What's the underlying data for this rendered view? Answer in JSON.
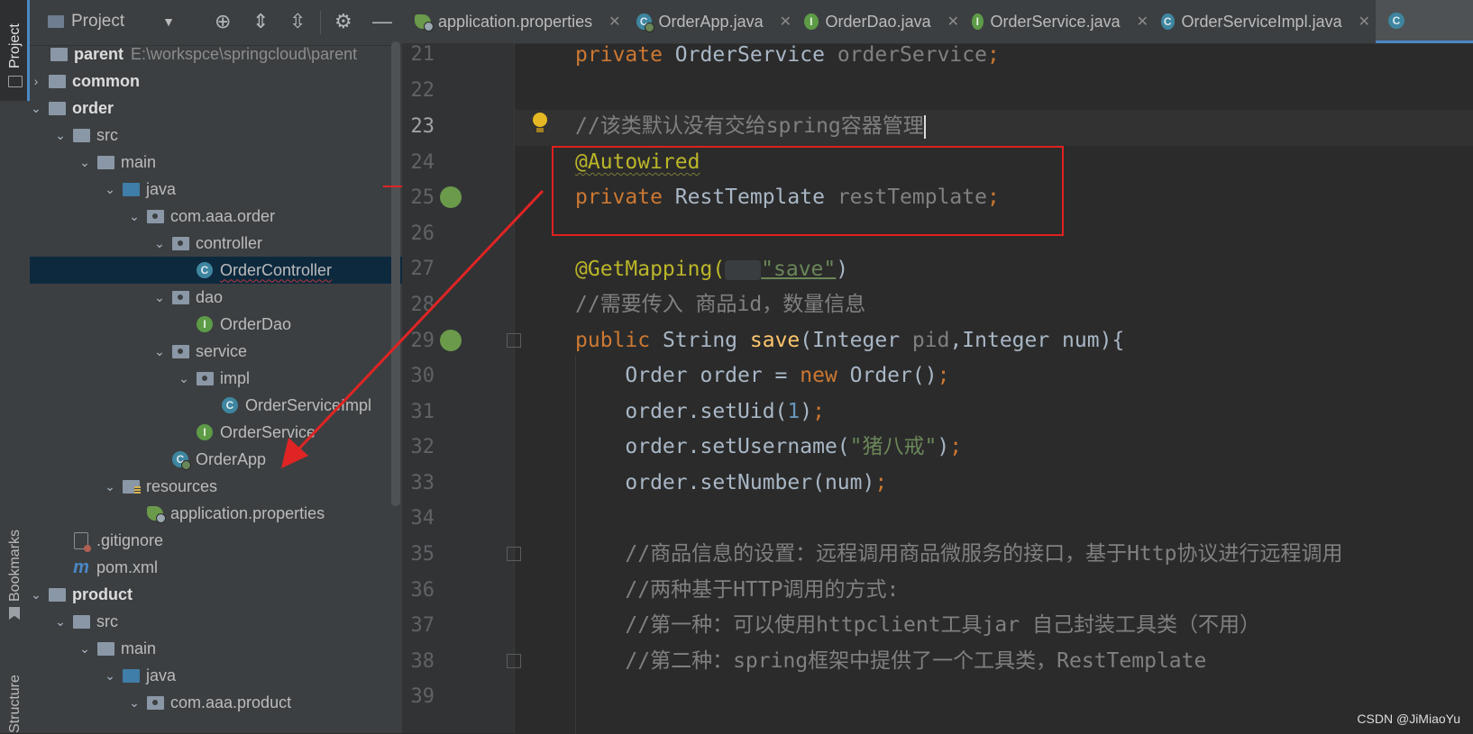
{
  "left_strip": {
    "project_label": "Project",
    "bookmarks_label": "Bookmarks",
    "structure_label": "Structure"
  },
  "project_panel": {
    "title": "Project",
    "tree": [
      {
        "name": "parent",
        "path": "E:\\workspce\\springcloud\\parent",
        "bold": true,
        "icon": "module-folder-icon"
      },
      {
        "name": "common",
        "bold": true,
        "icon": "module-folder-icon",
        "collapsed": true
      },
      {
        "name": "order",
        "bold": true,
        "icon": "module-folder-icon",
        "expanded": true
      },
      {
        "name": "src",
        "icon": "folder-icon",
        "expanded": true
      },
      {
        "name": "main",
        "icon": "folder-icon",
        "expanded": true
      },
      {
        "name": "java",
        "icon": "source-folder-icon",
        "expanded": true
      },
      {
        "name": "com.aaa.order",
        "icon": "package-icon",
        "expanded": true
      },
      {
        "name": "controller",
        "icon": "package-icon",
        "expanded": true
      },
      {
        "name": "OrderController",
        "icon": "class-icon",
        "selected": true
      },
      {
        "name": "dao",
        "icon": "package-icon",
        "expanded": true
      },
      {
        "name": "OrderDao",
        "icon": "interface-icon"
      },
      {
        "name": "service",
        "icon": "package-icon",
        "expanded": true
      },
      {
        "name": "impl",
        "icon": "package-icon",
        "expanded": true
      },
      {
        "name": "OrderServiceImpl",
        "icon": "class-icon"
      },
      {
        "name": "OrderService",
        "icon": "interface-icon"
      },
      {
        "name": "OrderApp",
        "icon": "spring-boot-class-icon"
      },
      {
        "name": "resources",
        "icon": "resources-folder-icon",
        "expanded": true
      },
      {
        "name": "application.properties",
        "icon": "spring-properties-icon"
      },
      {
        "name": ".gitignore",
        "icon": "gitignore-icon"
      },
      {
        "name": "pom.xml",
        "icon": "maven-icon"
      },
      {
        "name": "product",
        "bold": true,
        "icon": "module-folder-icon",
        "expanded": true
      },
      {
        "name": "src",
        "icon": "folder-icon",
        "expanded": true
      },
      {
        "name": "main",
        "icon": "folder-icon",
        "expanded": true
      },
      {
        "name": "java",
        "icon": "source-folder-icon",
        "expanded": true
      },
      {
        "name": "com.aaa.product",
        "icon": "package-icon",
        "expanded": true
      }
    ]
  },
  "tabs": [
    {
      "label": "application.properties",
      "icon": "spring-properties-icon"
    },
    {
      "label": "OrderApp.java",
      "icon": "spring-boot-class-icon"
    },
    {
      "label": "OrderDao.java",
      "icon": "interface-icon"
    },
    {
      "label": "OrderService.java",
      "icon": "interface-icon"
    },
    {
      "label": "OrderServiceImpl.java",
      "icon": "class-icon"
    }
  ],
  "editor": {
    "line_numbers": [
      "21",
      "22",
      "23",
      "24",
      "25",
      "26",
      "27",
      "28",
      "29",
      "30",
      "31",
      "32",
      "33",
      "34",
      "35",
      "36",
      "37",
      "38",
      "39"
    ],
    "lines": {
      "l21_kw": "private",
      "l21_type": " OrderService ",
      "l21_field": "orderService",
      "l21_end": ";",
      "l23": "//该类默认没有交给spring容器管理",
      "l24": "@Autowired",
      "l25_kw": "private",
      "l25_type": " RestTemplate ",
      "l25_field": "restTemplate",
      "l25_end": ";",
      "l27_an": "@GetMapping(",
      "l27_str": "\"save\"",
      "l27_end": ")",
      "l28": "//需要传入 商品id，数量信息",
      "l29_kw": "public",
      "l29_a": " String ",
      "l29_fn": "save",
      "l29_b": "(Integer ",
      "l29_p": "pid",
      "l29_c": ",Integer num){",
      "l30_a": "    Order order = ",
      "l30_kw": "new",
      "l30_b": " Order()",
      "l30_end": ";",
      "l31_a": "    order.setUid(",
      "l31_num": "1",
      "l31_b": ")",
      "l31_end": ";",
      "l32_a": "    order.setUsername(",
      "l32_str": "\"猪八戒\"",
      "l32_b": ")",
      "l32_end": ";",
      "l33_a": "    order.setNumber(num)",
      "l33_end": ";",
      "l35": "    //商品信息的设置：远程调用商品微服务的接口，基于Http协议进行远程调用",
      "l36": "    //两种基于HTTP调用的方式:",
      "l37": "    //第一种：可以使用httpclient工具jar 自己封装工具类（不用）",
      "l38": "    //第二种：spring框架中提供了一个工具类，RestTemplate"
    }
  },
  "watermark": "CSDN @JiMiaoYu"
}
